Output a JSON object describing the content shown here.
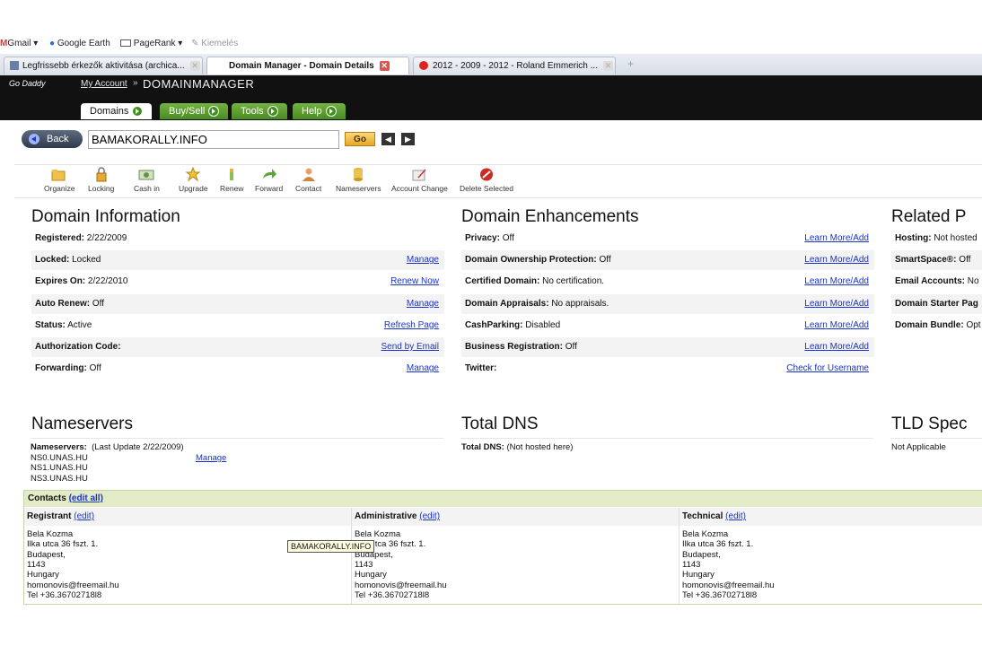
{
  "browser": {
    "bookmarks": [
      {
        "label": "Gmail",
        "icon": "gmail-icon"
      },
      {
        "label": "Google Earth",
        "icon": "globe-icon"
      },
      {
        "label": "PageRank",
        "icon": "pagerank-icon"
      },
      {
        "label": "Kiemelés",
        "icon": "highlight-icon"
      }
    ],
    "tabs": [
      {
        "label": "Legfrissebb érkezők aktivitása (archica..."
      },
      {
        "label": "Domain Manager - Domain Details"
      },
      {
        "label": "2012 - 2009 - 2012 - Roland Emmerich ..."
      }
    ],
    "new_tab": "+"
  },
  "header": {
    "logo": "Go Daddy",
    "my_account": "My Account",
    "separator": "»",
    "title": "DOMAINMANAGER",
    "nav": [
      {
        "label": "Domains"
      },
      {
        "label": "Buy/Sell"
      },
      {
        "label": "Tools"
      },
      {
        "label": "Help"
      }
    ]
  },
  "search": {
    "back_label": "Back",
    "domain_value": "BAMAKORALLY.INFO",
    "go_label": "Go",
    "prev": "◀",
    "next": "▶"
  },
  "toolbar": [
    {
      "label": "Organize",
      "icon": "folder-icon"
    },
    {
      "label": "Locking",
      "icon": "lock-icon"
    },
    {
      "label": "Cash in",
      "icon": "cash-icon"
    },
    {
      "label": "Upgrade",
      "icon": "star-icon"
    },
    {
      "label": "Renew",
      "icon": "renew-icon"
    },
    {
      "label": "Forward",
      "icon": "forward-arrow-icon"
    },
    {
      "label": "Contact",
      "icon": "contact-person-icon"
    },
    {
      "label": "Nameservers",
      "icon": "server-stack-icon"
    },
    {
      "label": "Account Change",
      "icon": "account-change-icon"
    },
    {
      "label": "Delete Selected",
      "icon": "delete-icon"
    }
  ],
  "domain_info": {
    "title": "Domain Information",
    "rows": [
      {
        "key": "Registered:",
        "value": "2/22/2009",
        "action": ""
      },
      {
        "key": "Locked:",
        "value": "Locked",
        "action": "Manage"
      },
      {
        "key": "Expires On:",
        "value": "2/22/2010",
        "action": "Renew Now"
      },
      {
        "key": "Auto Renew:",
        "value": "Off",
        "action": "Manage"
      },
      {
        "key": "Status:",
        "value": "Active",
        "action": "Refresh Page"
      },
      {
        "key": "Authorization Code:",
        "value": "",
        "action": "Send by Email"
      },
      {
        "key": "Forwarding:",
        "value": "Off",
        "action": "Manage"
      }
    ]
  },
  "enhancements": {
    "title": "Domain Enhancements",
    "rows": [
      {
        "key": "Privacy:",
        "value": "Off",
        "action": "Learn More/Add"
      },
      {
        "key": "Domain Ownership Protection:",
        "value": "Off",
        "action": "Learn More/Add"
      },
      {
        "key": "Certified Domain:",
        "value": "No certification.",
        "action": "Learn More/Add"
      },
      {
        "key": "Domain Appraisals:",
        "value": "No appraisals.",
        "action": "Learn More/Add"
      },
      {
        "key": "CashParking:",
        "value": "Disabled",
        "action": "Learn More/Add"
      },
      {
        "key": "Business Registration:",
        "value": "Off",
        "action": "Learn More/Add"
      },
      {
        "key": "Twitter:",
        "value": "",
        "action": "Check for Username"
      }
    ]
  },
  "related": {
    "title": "Related P",
    "rows": [
      {
        "key": "Hosting:",
        "value": "Not hosted"
      },
      {
        "key": "SmartSpace®:",
        "value": "Off"
      },
      {
        "key": "Email Accounts:",
        "value": "No"
      },
      {
        "key": "Domain Starter Pag",
        "value": ""
      },
      {
        "key": "Domain Bundle:",
        "value": "Opt"
      }
    ]
  },
  "nameservers": {
    "title": "Nameservers",
    "label": "Nameservers:",
    "update": "(Last Update 2/22/2009)",
    "manage": "Manage",
    "servers": [
      "NS0.UNAS.HU",
      "NS1.UNAS.HU",
      "NS3.UNAS.HU"
    ]
  },
  "total_dns": {
    "title": "Total DNS",
    "label": "Total DNS:",
    "value": "(Not hosted here)"
  },
  "tld": {
    "title": "TLD Spec",
    "value": "Not Applicable"
  },
  "contacts": {
    "title": "Contacts",
    "edit_all": "(edit all)",
    "edit": "(edit)",
    "columns": [
      {
        "role": "Registrant",
        "lines": [
          "Bela Kozma",
          "Ilka utca 36 fszt. 1.",
          "Budapest,",
          "1143",
          "Hungary",
          "homonovis@freemail.hu",
          "Tel +36.36702718l8"
        ]
      },
      {
        "role": "Administrative",
        "lines": [
          "Bela Kozma",
          "Ilka utca 36 fszt. 1.",
          "Budapest,",
          "1143",
          "Hungary",
          "homonovis@freemail.hu",
          "Tel +36.36702718l8"
        ]
      },
      {
        "role": "Technical",
        "lines": [
          "Bela Kozma",
          "Ilka utca 36 fszt. 1.",
          "Budapest,",
          "1143",
          "Hungary",
          "homonovis@freemail.hu",
          "Tel +36.36702718l8"
        ]
      }
    ],
    "tooltip": "BAMAKORALLY.INFO"
  }
}
